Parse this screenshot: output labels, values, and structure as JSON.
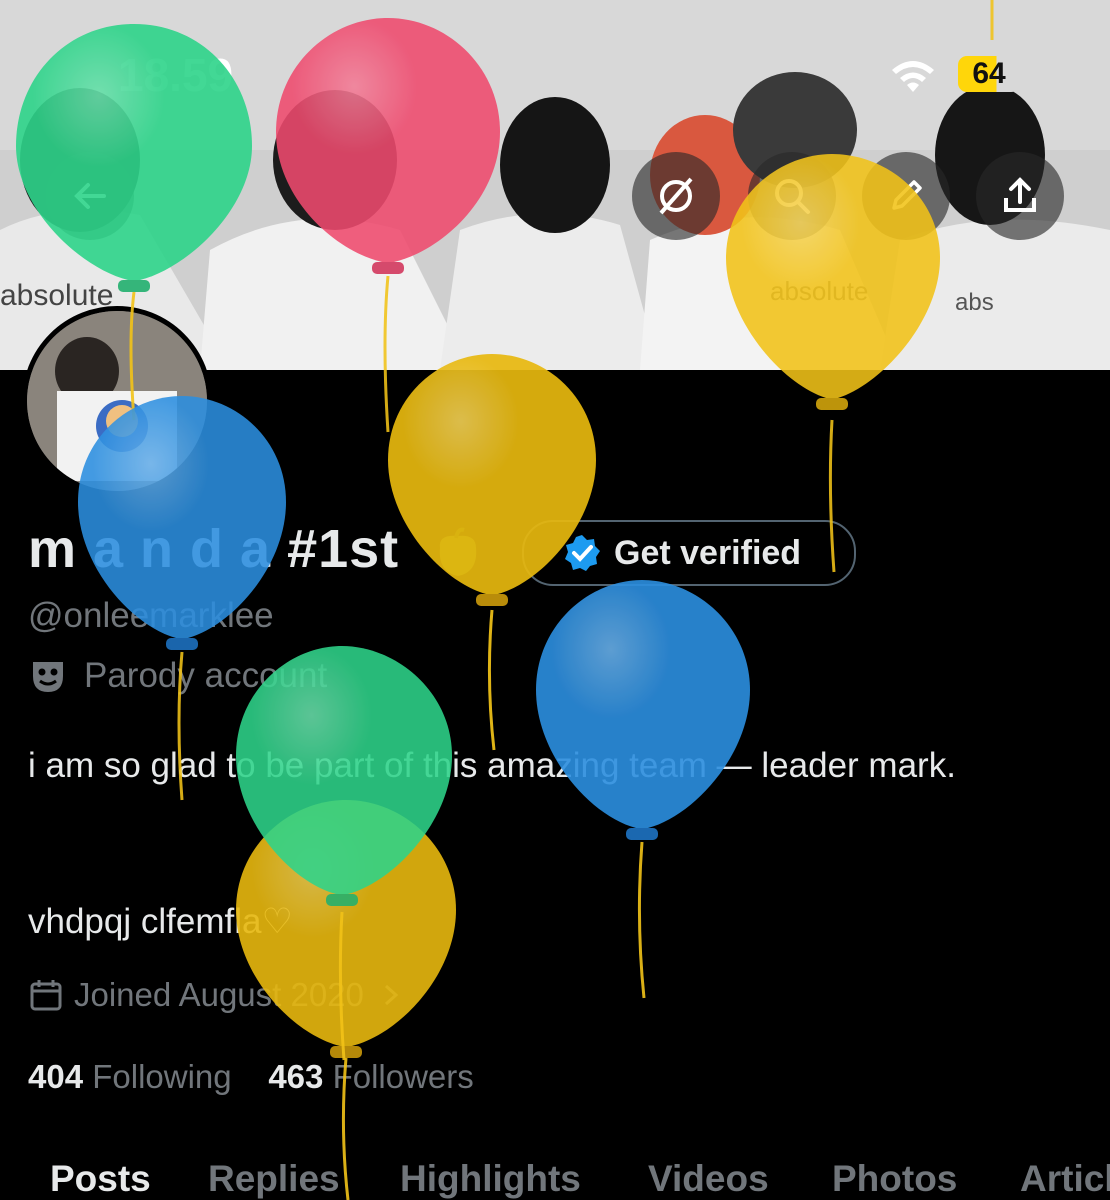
{
  "status_bar": {
    "time": "18.59",
    "battery": "64"
  },
  "profile": {
    "name": "m a n d a #1st",
    "verify_button": "Get verified",
    "handle": "@onleemarklee",
    "parody_label": "Parody account",
    "bio_line1": "i am so glad to be part of this amazing team — leader mark.",
    "bio_line2": "vhdpqj clfemfla♡",
    "joined": "Joined August 2020",
    "following_count": "404",
    "following_label": "Following",
    "followers_count": "463",
    "followers_label": "Followers"
  },
  "tabs": [
    "Posts",
    "Replies",
    "Highlights",
    "Videos",
    "Photos",
    "Articles"
  ],
  "icons": {
    "back": "arrow-left-icon",
    "grok": "slash-circle-icon",
    "search": "search-icon",
    "edit": "pencil-icon",
    "share": "share-icon",
    "parody": "mask-icon",
    "calendar": "calendar-icon",
    "verified": "verified-badge-icon"
  },
  "colors": {
    "background": "#000000",
    "text": "#e7e9ea",
    "secondary": "#71767b",
    "verified_blue": "#1d9bf0",
    "balloon_green": "#2ed48a",
    "balloon_pink": "#ef4a6e",
    "balloon_yellow": "#f2c318",
    "balloon_blue": "#2c8fe0"
  }
}
